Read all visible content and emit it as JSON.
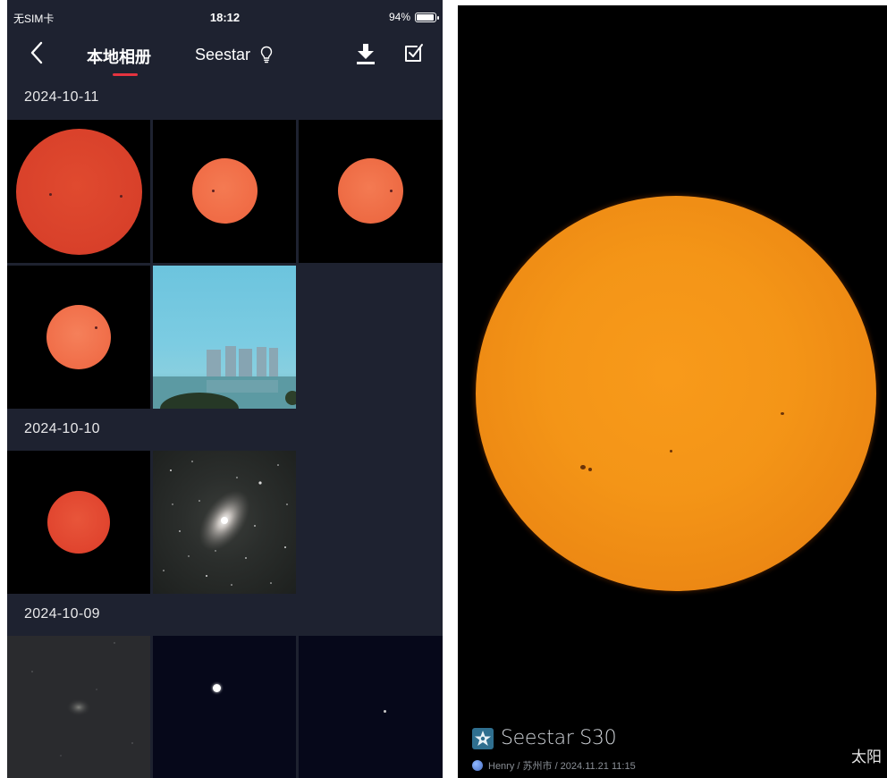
{
  "status_bar": {
    "carrier": "无SIM卡",
    "time": "18:12",
    "battery_percent": "94%",
    "battery_level": 0.94
  },
  "nav": {
    "back_icon": "chevron-left-icon",
    "tabs": [
      {
        "label": "本地相册",
        "active": true
      },
      {
        "label": "Seestar",
        "icon": "lightbulb-icon",
        "active": false
      }
    ],
    "download_icon": "download-icon",
    "select_icon": "checkbox-icon",
    "active_tab_color": "#e5333f"
  },
  "album": {
    "groups": [
      {
        "date": "2024-10-11",
        "photos": [
          {
            "subject": "sun",
            "color": "#d8402a"
          },
          {
            "subject": "sun",
            "color": "#f06b45"
          },
          {
            "subject": "sun",
            "color": "#ed6a43"
          },
          {
            "subject": "sun",
            "color": "#f06d48"
          },
          {
            "subject": "city-landscape",
            "color": "#76c9e0"
          }
        ]
      },
      {
        "date": "2024-10-10",
        "photos": [
          {
            "subject": "sun",
            "color": "#e0442e"
          },
          {
            "subject": "galaxy",
            "color": "#2b2e2c"
          }
        ]
      },
      {
        "date": "2024-10-09",
        "photos": [
          {
            "subject": "galaxy",
            "color": "#2a2b2e"
          },
          {
            "subject": "star",
            "color": "#06081a"
          },
          {
            "subject": "star",
            "color": "#06081a"
          }
        ]
      }
    ],
    "background_color": "#1e2230"
  },
  "viewer": {
    "brand": "Seestar S30",
    "credit": "Henry / 苏州市 / 2024.11.21 11:15",
    "object_name": "太阳",
    "sun_color": "#f49517"
  }
}
